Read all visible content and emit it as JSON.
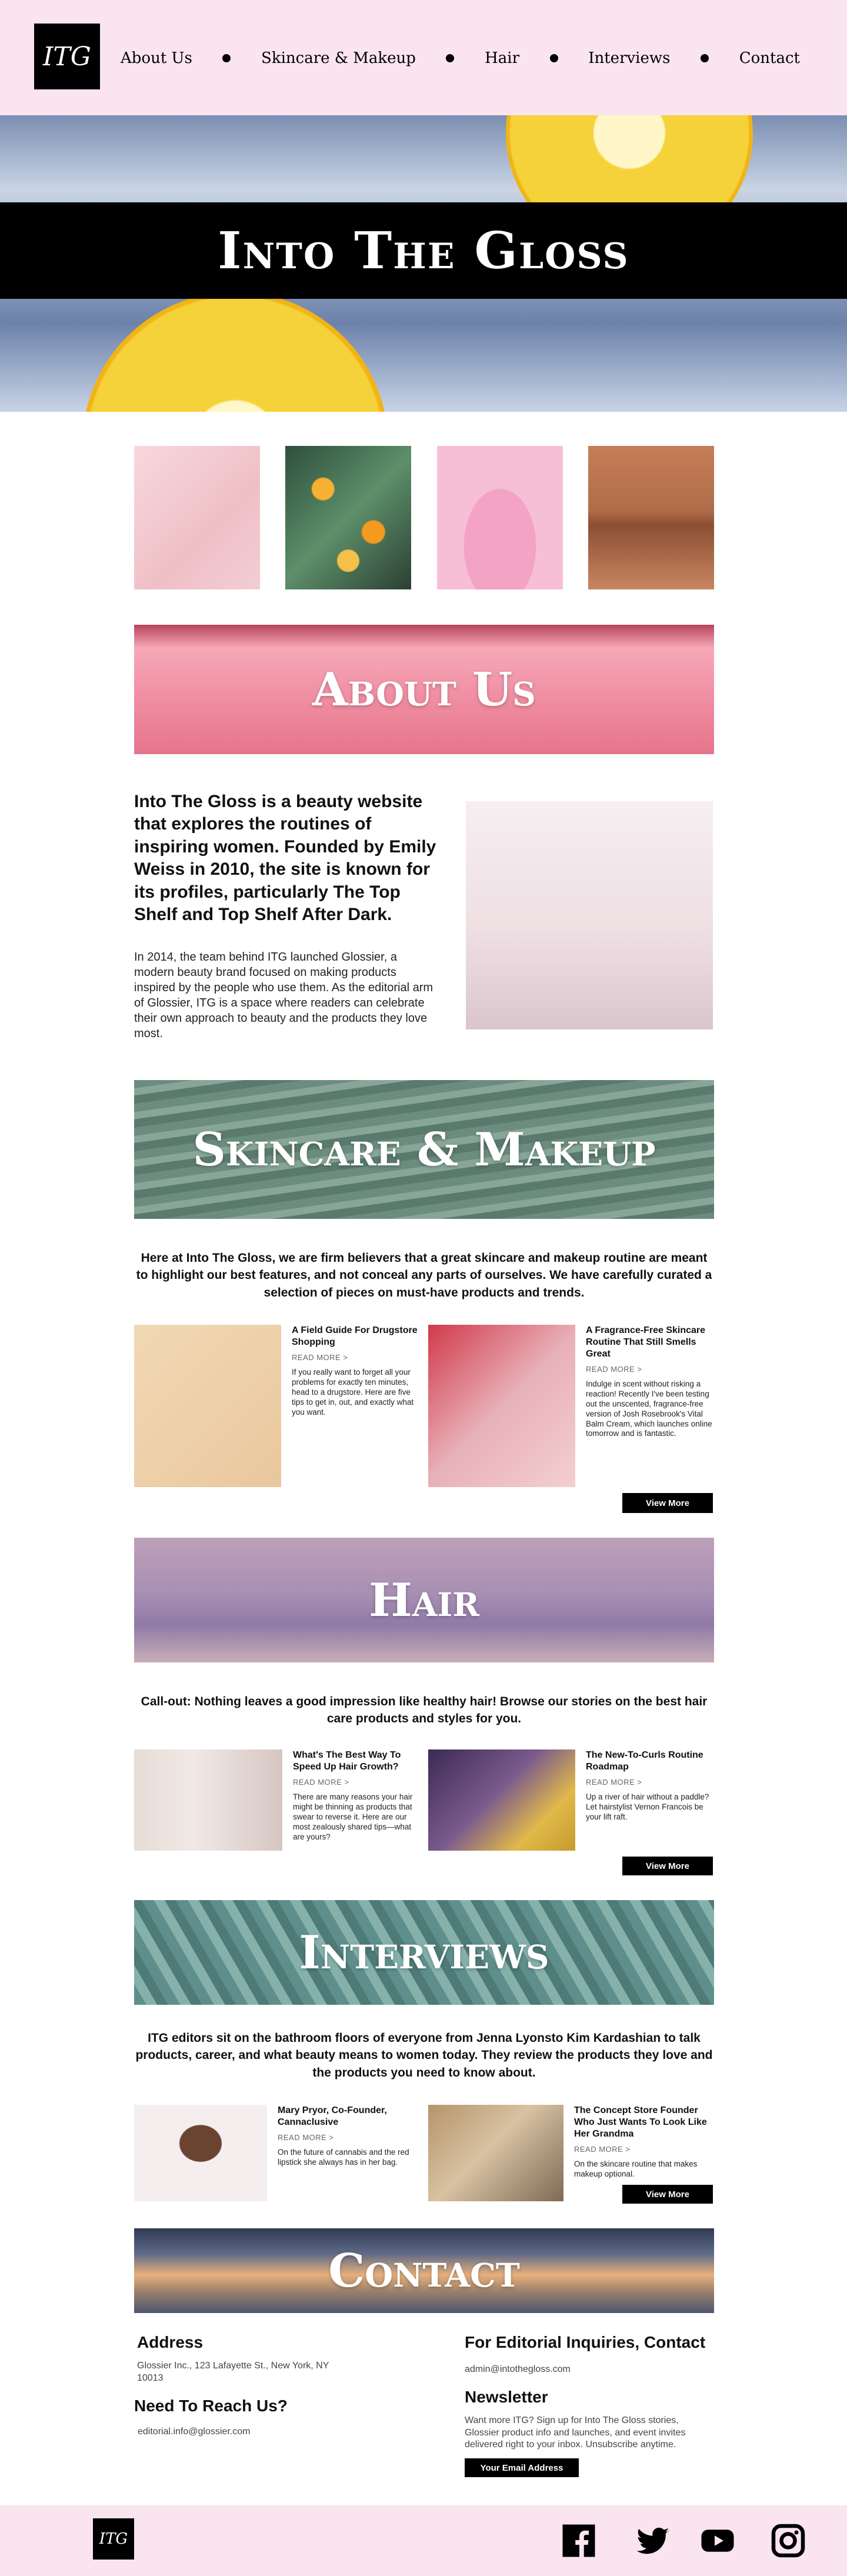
{
  "brand": {
    "logo_text": "ITG"
  },
  "nav": {
    "items": [
      {
        "label": "About Us"
      },
      {
        "label": "Skincare & Makeup"
      },
      {
        "label": "Hair"
      },
      {
        "label": "Interviews"
      },
      {
        "label": "Contact"
      }
    ]
  },
  "hero": {
    "title": "Into The Gloss"
  },
  "about": {
    "title": "About Us",
    "lead": "Into The Gloss is a beauty website that explores the routines of inspiring women. Founded by Emily Weiss in 2010, the site is known for its profiles, particularly The Top Shelf and Top Shelf After Dark.",
    "body": "In 2014, the team behind ITG launched Glossier, a modern beauty brand focused on making products inspired by the people who use them. As the editorial arm of Glossier, ITG is a space where readers can celebrate their own approach to beauty and the products they love most."
  },
  "skincare": {
    "title": "Skincare & Makeup",
    "callout": "Here at Into The Gloss, we are firm believers that a great skincare and makeup routine are meant to highlight our best features, and not conceal any parts of ourselves. We have carefully curated a selection of pieces on must-have products and trends.",
    "cards": [
      {
        "title": "A Field Guide For Drugstore Shopping",
        "more": "READ MORE >",
        "body": "If you really want to forget all your problems for exactly ten minutes, head to a drugstore. Here are five tips to get in, out, and exactly what you want."
      },
      {
        "title": "A Fragrance-Free Skincare Routine That Still Smells Great",
        "more": "READ MORE >",
        "body": "Indulge in scent without risking a reaction! Recently I've been testing out the unscented, fragrance-free version of Josh Rosebrook's Vital Balm Cream, which launches online tomorrow and is fantastic."
      }
    ],
    "view_more": "View More"
  },
  "hair": {
    "title": "Hair",
    "callout": "Call-out: Nothing leaves a good impression like healthy hair! Browse our stories on the best hair care products and styles for you.",
    "cards": [
      {
        "title": "What's The Best Way To Speed Up Hair Growth?",
        "more": "READ MORE >",
        "body": "There are many reasons your hair might be thinning as products that swear to reverse it. Here are our most zealously shared tips—what are yours?"
      },
      {
        "title": "The New-To-Curls Routine Roadmap",
        "more": "READ MORE >",
        "body": "Up a river of hair without a paddle? Let hairstylist Vernon Francois be your lift raft."
      }
    ],
    "view_more": "View More"
  },
  "interviews": {
    "title": "Interviews",
    "callout": "ITG editors sit on the bathroom floors of everyone from Jenna Lyonsto Kim Kardashian to talk products, career, and what beauty means to women today. They review the products they love and the products you need to know about.",
    "cards": [
      {
        "title": "Mary Pryor, Co-Founder, Cannaclusive",
        "more": "READ MORE >",
        "body": "On the future of cannabis and the red lipstick she always has in her bag."
      },
      {
        "title": "The Concept Store Founder Who Just Wants To Look Like Her Grandma",
        "more": "READ MORE >",
        "body": "On the skincare routine that makes makeup optional."
      }
    ],
    "view_more": "View More"
  },
  "contact": {
    "title": "Contact",
    "address_heading": "Address",
    "address": "Glossier Inc., 123 Lafayette St., New York, NY 10013",
    "reach_heading": "Need To Reach Us?",
    "reach_email": "editorial.info@glossier.com",
    "editorial_heading": "For Editorial Inquiries, Contact",
    "editorial_email": "admin@intothegloss.com",
    "newsletter_heading": "Newsletter",
    "newsletter_body": "Want more ITG? Sign up for Into The Gloss stories, Glossier product info and launches, and event invites delivered right to your inbox. Unsubscribe anytime.",
    "newsletter_button": "Your Email Address"
  },
  "footer": {
    "logo_text": "ITG",
    "social": [
      "facebook-icon",
      "twitter-icon",
      "youtube-icon",
      "instagram-icon"
    ]
  },
  "colors": {
    "nav_bg": "#f9e4ef",
    "black": "#000000"
  }
}
